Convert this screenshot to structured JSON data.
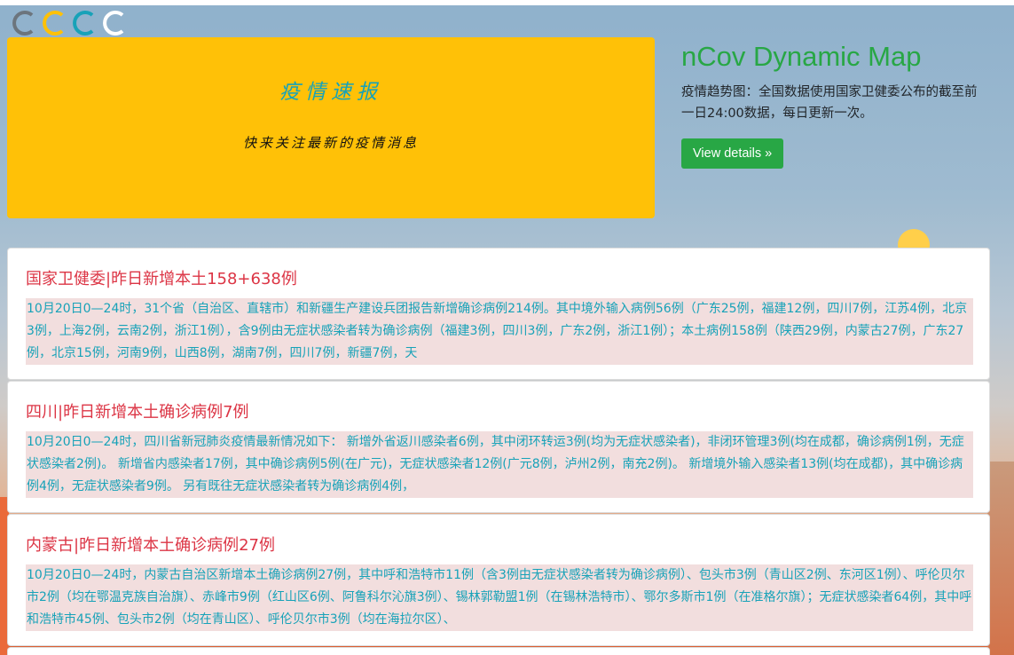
{
  "header": {
    "logo_icon": "cccc-logo-icon"
  },
  "banner": {
    "title": "疫情速报",
    "subtitle": "快来关注最新的疫情消息"
  },
  "side": {
    "title": "nCov Dynamic Map",
    "description": "疫情趋势图：全国数据使用国家卫健委公布的截至前一日24:00数据，每日更新一次。",
    "button_label": "View details »"
  },
  "cards": [
    {
      "title": "国家卫健委|昨日新增本土158+638例",
      "body": "10月20日0—24时，31个省（自治区、直辖市）和新疆生产建设兵团报告新增确诊病例214例。其中境外输入病例56例（广东25例，福建12例，四川7例，江苏4例，北京3例，上海2例，云南2例，浙江1例），含9例由无症状感染者转为确诊病例（福建3例，四川3例，广东2例，浙江1例）；本土病例158例（陕西29例，内蒙古27例，广东27例，北京15例，河南9例，山西8例，湖南7例，四川7例，新疆7例，天"
    },
    {
      "title": "四川|昨日新增本土确诊病例7例",
      "body": "10月20日0—24时，四川省新冠肺炎疫情最新情况如下： 新增外省返川感染者6例，其中闭环转运3例(均为无症状感染者)，非闭环管理3例(均在成都，确诊病例1例，无症状感染者2例)。 新增省内感染者17例，其中确诊病例5例(在广元)，无症状感染者12例(广元8例，泸州2例，南充2例)。 新增境外输入感染者13例(均在成都)，其中确诊病例4例，无症状感染者9例。 另有既往无症状感染者转为确诊病例4例，"
    },
    {
      "title": "内蒙古|昨日新增本土确诊病例27例",
      "body": "10月20日0—24时，内蒙古自治区新增本土确诊病例27例，其中呼和浩特市11例（含3例由无症状感染者转为确诊病例）、包头市3例（青山区2例、东河区1例）、呼伦贝尔市2例（均在鄂温克族自治旗）、赤峰市9例（红山区6例、阿鲁科尔沁旗3例）、锡林郭勒盟1例（在锡林浩特市）、鄂尔多斯市1例（在准格尔旗）；无症状感染者64例，其中呼和浩特市45例、包头市2例（均在青山区）、呼伦贝尔市3例（均在海拉尔区）、"
    }
  ],
  "colors": {
    "banner_bg": "#ffc107",
    "title_green": "#28a745",
    "card_title_red": "#dc3545",
    "body_text_teal": "#17a2b8",
    "body_bg_pink": "#f2dede"
  }
}
